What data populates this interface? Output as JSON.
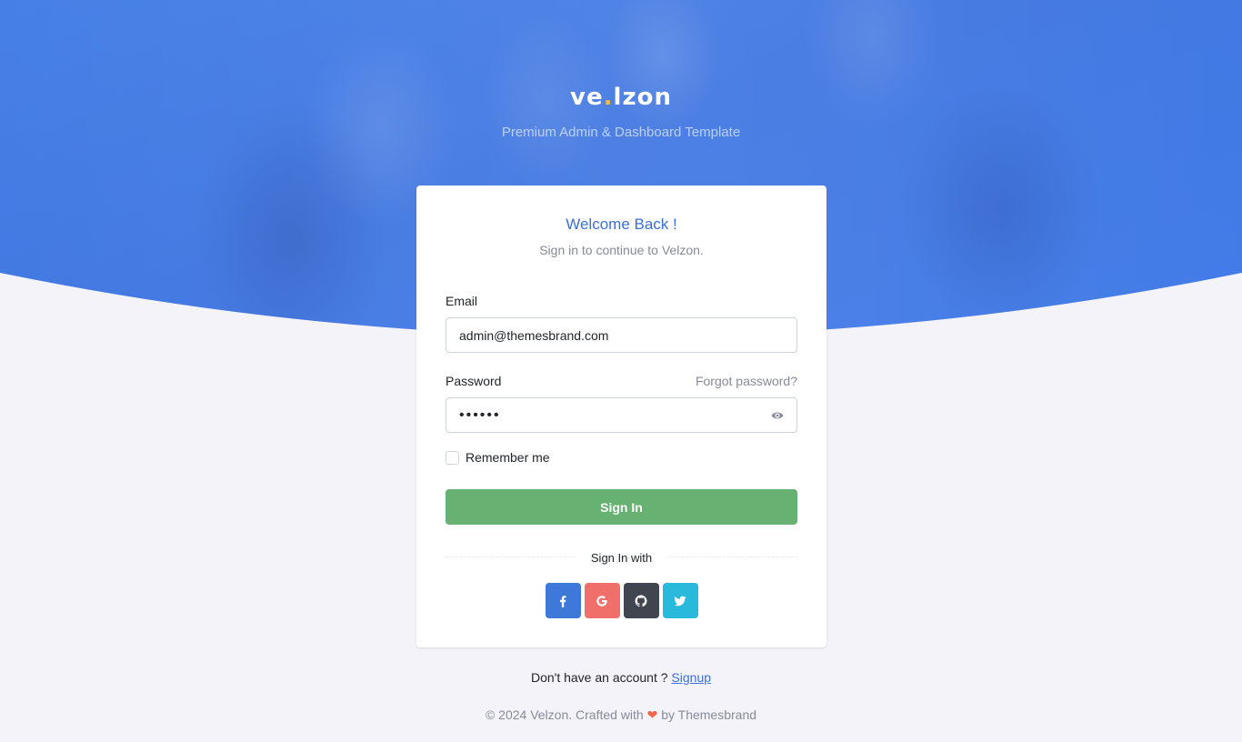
{
  "brand": {
    "logo_text_a": "ve",
    "logo_dot": ".",
    "logo_text_b": "lzon",
    "tagline": "Premium Admin & Dashboard Template"
  },
  "card": {
    "title": "Welcome Back !",
    "subtitle": "Sign in to continue to Velzon."
  },
  "form": {
    "email_label": "Email",
    "email_value": "admin@themesbrand.com",
    "password_label": "Password",
    "forgot_label": "Forgot password?",
    "password_value": "123456",
    "remember_label": "Remember me",
    "signin_label": "Sign In"
  },
  "social": {
    "heading": "Sign In with",
    "buttons": [
      {
        "name": "facebook",
        "icon": "facebook-icon",
        "color": "#3e78d9"
      },
      {
        "name": "google",
        "icon": "google-icon",
        "color": "#f06f6a"
      },
      {
        "name": "github",
        "icon": "github-icon",
        "color": "#40454f"
      },
      {
        "name": "twitter",
        "icon": "twitter-icon",
        "color": "#29badb"
      }
    ]
  },
  "footer": {
    "signup_prompt": "Don't have an account ? ",
    "signup_link": "Signup",
    "copyright_a": "© 2024 Velzon. Crafted with ",
    "copyright_b": " by Themesbrand"
  },
  "colors": {
    "hero": "#3b77e8",
    "primary": "#3b6fd9",
    "success": "#67b173",
    "background": "#f3f3f9"
  }
}
